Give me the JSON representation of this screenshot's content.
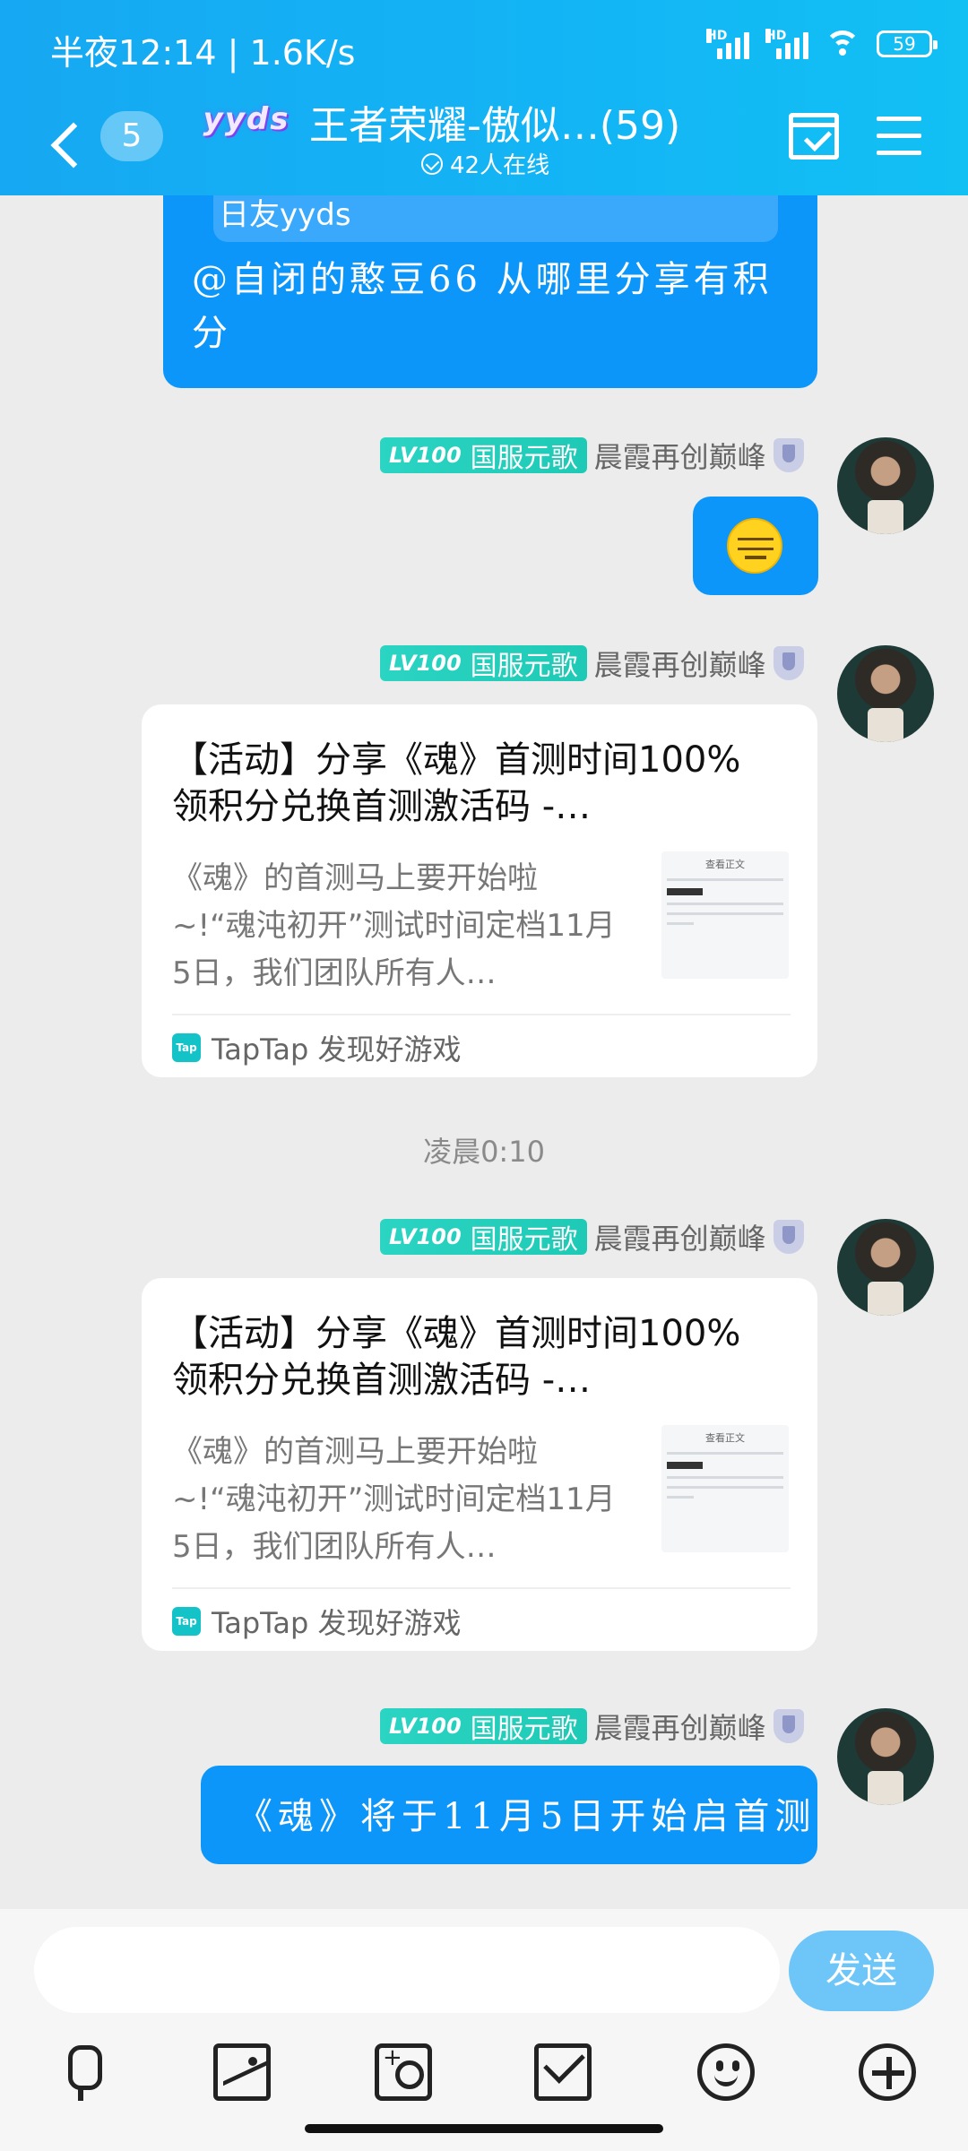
{
  "status": {
    "time": "半夜12:14",
    "speed": "1.6K/s",
    "battery": "59"
  },
  "nav": {
    "unread": "5",
    "group_logo": "yyds",
    "group_title": "王者荣耀-傲似…(59)",
    "online": "42人在线"
  },
  "messages": {
    "quote_text": "日友yyds",
    "mention_text": "@自闭的憨豆66 从哪里分享有积分",
    "sender": {
      "level": "LV100",
      "title": "国服元歌",
      "nickname": "晨霞再创巅峰"
    },
    "card": {
      "title": "【活动】分享《魂》首测时间100%领积分兑换首测激活码 -…",
      "description": "《魂》的首测马上要开始啦~!“魂沌初开”测试时间定档11月5日，我们团队所有人…",
      "thumb_title": "查看正文",
      "source": "TapTap 发现好游戏",
      "source_icon": "Tap"
    },
    "timestamp": "凌晨0:10",
    "final_text": "《魂》将于11月5日开始启首测"
  },
  "input": {
    "placeholder": "",
    "send_label": "发送"
  },
  "colors": {
    "header": "#16a8f2",
    "bubble": "#0d96f9",
    "send_button": "#6ec6f8",
    "level_badge": "#2bd4c3"
  },
  "icons": [
    "back-icon",
    "calendar-check-icon",
    "menu-icon",
    "microphone-icon",
    "image-icon",
    "camera-icon",
    "red-packet-icon",
    "emoji-icon",
    "plus-icon"
  ]
}
